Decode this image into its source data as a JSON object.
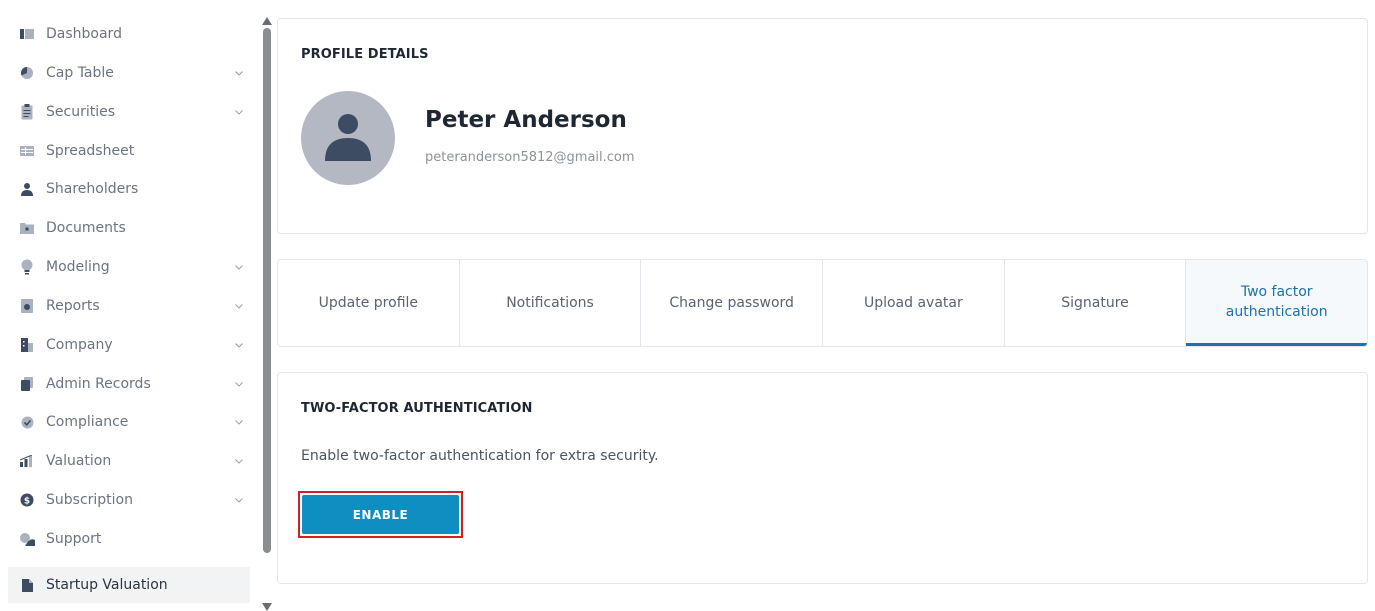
{
  "sidebar": {
    "items": [
      {
        "label": "Dashboard",
        "icon": "dashboard-icon",
        "has_chevron": false
      },
      {
        "label": "Cap Table",
        "icon": "pie-chart-icon",
        "has_chevron": true
      },
      {
        "label": "Securities",
        "icon": "clipboard-icon",
        "has_chevron": true
      },
      {
        "label": "Spreadsheet",
        "icon": "table-icon",
        "has_chevron": false
      },
      {
        "label": "Shareholders",
        "icon": "person-icon",
        "has_chevron": false
      },
      {
        "label": "Documents",
        "icon": "folder-icon",
        "has_chevron": false
      },
      {
        "label": "Modeling",
        "icon": "lightbulb-icon",
        "has_chevron": true
      },
      {
        "label": "Reports",
        "icon": "report-icon",
        "has_chevron": true
      },
      {
        "label": "Company",
        "icon": "building-icon",
        "has_chevron": true
      },
      {
        "label": "Admin Records",
        "icon": "records-icon",
        "has_chevron": true
      },
      {
        "label": "Compliance",
        "icon": "shield-check-icon",
        "has_chevron": true
      },
      {
        "label": "Valuation",
        "icon": "bar-chart-icon",
        "has_chevron": true
      },
      {
        "label": "Subscription",
        "icon": "dollar-icon",
        "has_chevron": true
      },
      {
        "label": "Support",
        "icon": "support-icon",
        "has_chevron": false
      },
      {
        "label": "Startup Valuation",
        "icon": "document-icon",
        "has_chevron": false,
        "active": true
      }
    ]
  },
  "profile": {
    "section_title": "PROFILE DETAILS",
    "name": "Peter Anderson",
    "email": "peteranderson5812@gmail.com"
  },
  "tabs": [
    {
      "label": "Update profile"
    },
    {
      "label": "Notifications"
    },
    {
      "label": "Change password"
    },
    {
      "label": "Upload avatar"
    },
    {
      "label": "Signature"
    },
    {
      "label": "Two factor authentication",
      "active": true
    }
  ],
  "twofa": {
    "title": "TWO-FACTOR AUTHENTICATION",
    "description": "Enable two-factor authentication for extra security.",
    "button_label": "ENABLE"
  },
  "colors": {
    "accent": "#1c73a8",
    "button": "#0f8ec2",
    "highlight_border": "#d21f26",
    "avatar_bg": "#b3b8c2",
    "avatar_fg": "#3d4b63",
    "icon_dark": "#3d4b63"
  }
}
